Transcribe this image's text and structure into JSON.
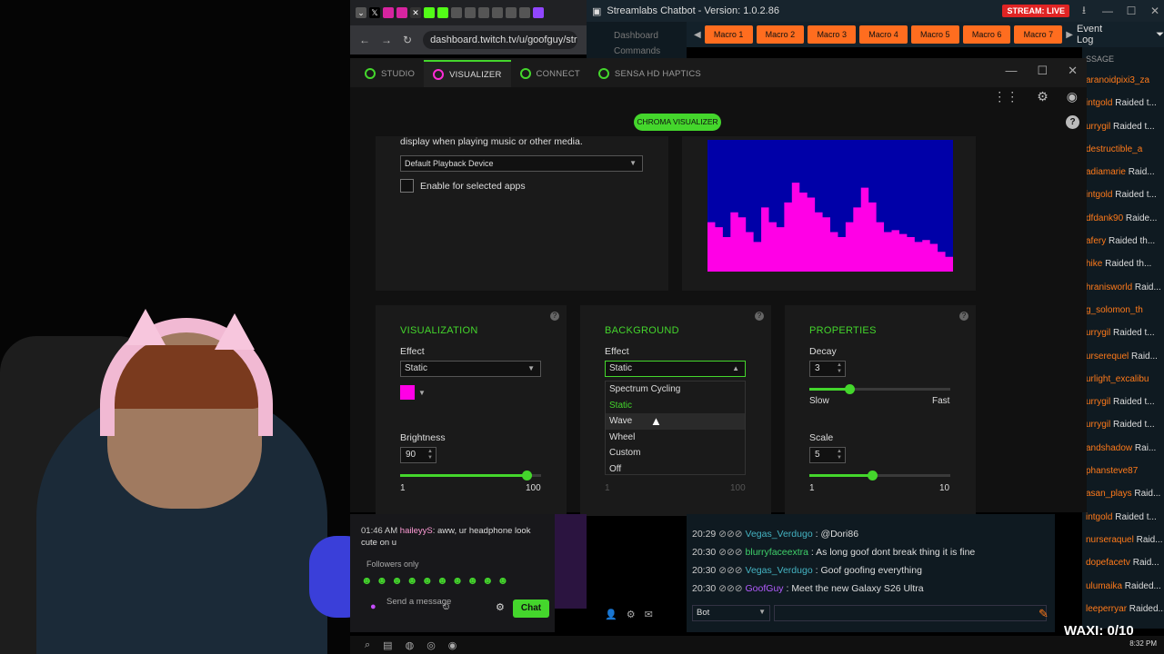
{
  "browser": {
    "url": "dashboard.twitch.tv/u/goofguy/stre",
    "tab_close": "✕"
  },
  "streamlabs": {
    "title": "Streamlabs Chatbot - Version: 1.0.2.86",
    "live_badge": "STREAM: LIVE",
    "nav": [
      "Dashboard",
      "Commands"
    ],
    "macros": [
      "Macro 1",
      "Macro 2",
      "Macro 3",
      "Macro 4",
      "Macro 5",
      "Macro 6",
      "Macro 7"
    ],
    "event_log_title": "Event Log",
    "message_header": "SSAGE",
    "events": [
      {
        "name": "aranoidpixi3_za",
        "text": ""
      },
      {
        "name": "intgold",
        "text": " Raided t..."
      },
      {
        "name": "urrygil",
        "text": " Raided t..."
      },
      {
        "name": "destructible_a",
        "text": ""
      },
      {
        "name": "adiamarie",
        "text": " Raid..."
      },
      {
        "name": "intgold",
        "text": " Raided t..."
      },
      {
        "name": "dfdank90",
        "text": " Raide..."
      },
      {
        "name": "afery",
        "text": " Raided th..."
      },
      {
        "name": "hike",
        "text": " Raided th..."
      },
      {
        "name": "hranisworld",
        "text": " Raid..."
      },
      {
        "name": "g_solomon_th",
        "text": ""
      },
      {
        "name": "urrygil",
        "text": " Raided t..."
      },
      {
        "name": "urserequel",
        "text": " Raid..."
      },
      {
        "name": "urlight_excalibu",
        "text": ""
      },
      {
        "name": "urrygil",
        "text": " Raided t..."
      },
      {
        "name": "urrygil",
        "text": " Raided t..."
      },
      {
        "name": "andshadow",
        "text": " Rai..."
      },
      {
        "name": "phansteve87",
        "text": ""
      },
      {
        "name": "asan_plays",
        "text": " Raid..."
      },
      {
        "name": "intgold",
        "text": " Raided t..."
      },
      {
        "name": "nurseraquel",
        "text": " Raid..."
      },
      {
        "name": "dopefacetv",
        "text": " Raid..."
      },
      {
        "name": "ulumaika",
        "text": " Raided..."
      },
      {
        "name": "leeperryar",
        "text": " Raided..."
      }
    ],
    "chat": [
      {
        "time": "20:29",
        "user": "Vegas_Verdugo",
        "sep": " : ",
        "msg": "@Dori86",
        "color": "#44b3c2"
      },
      {
        "time": "20:30",
        "user": "blurryfaceextra",
        "sep": " : ",
        "msg": "As long goof dont break thing it is fine",
        "color": "#3fd16a"
      },
      {
        "time": "20:30",
        "user": "Vegas_Verdugo",
        "sep": " : ",
        "msg": "Goof goofing everything",
        "color": "#44b3c2"
      },
      {
        "time": "20:30",
        "user": "GoofGuy",
        "sep": " : ",
        "msg": "Meet the new Galaxy S26 Ultra",
        "color": "#b35cff"
      }
    ],
    "bot_select": "Bot"
  },
  "synapse": {
    "tabs": [
      "STUDIO",
      "VISUALIZER",
      "CONNECT",
      "SENSA HD HAPTICS"
    ],
    "chroma_button": "CHROMA VISUALIZER",
    "input_description": "display when playing music or other media.",
    "device": "Default Playback Device",
    "enable_label": "Enable for selected apps",
    "visualization": {
      "title": "VISUALIZATION",
      "effect_label": "Effect",
      "effect": "Static",
      "color": "#ff00e6",
      "brightness_label": "Brightness",
      "brightness": "90",
      "brightness_value": 90,
      "min": "1",
      "max": "100"
    },
    "background": {
      "title": "BACKGROUND",
      "effect_label": "Effect",
      "effect": "Static",
      "min": "1",
      "max": "100",
      "options": [
        "Spectrum Cycling",
        "Static",
        "Wave",
        "Wheel",
        "Custom",
        "Off"
      ]
    },
    "properties": {
      "title": "PROPERTIES",
      "decay_label": "Decay",
      "decay": "3",
      "decay_value": 3,
      "slow": "Slow",
      "fast": "Fast",
      "scale_label": "Scale",
      "scale": "5",
      "scale_value": 5,
      "min": "1",
      "max": "10"
    },
    "spectrum": [
      0.5,
      0.45,
      0.35,
      0.6,
      0.55,
      0.4,
      0.3,
      0.65,
      0.5,
      0.45,
      0.7,
      0.9,
      0.8,
      0.75,
      0.6,
      0.55,
      0.4,
      0.35,
      0.5,
      0.65,
      0.85,
      0.7,
      0.5,
      0.4,
      0.42,
      0.38,
      0.35,
      0.3,
      0.32,
      0.28,
      0.2,
      0.15
    ]
  },
  "twitch_chat": {
    "time": "01:46 AM",
    "user": "haileyyS",
    "msg": "aww, ur headphone look cute on u",
    "followers_only": "Followers only",
    "placeholder": "Send a message",
    "chat_button": "Chat"
  },
  "overlay": {
    "waxi": "WAXI: 0/10",
    "clock": "8:32 PM"
  }
}
